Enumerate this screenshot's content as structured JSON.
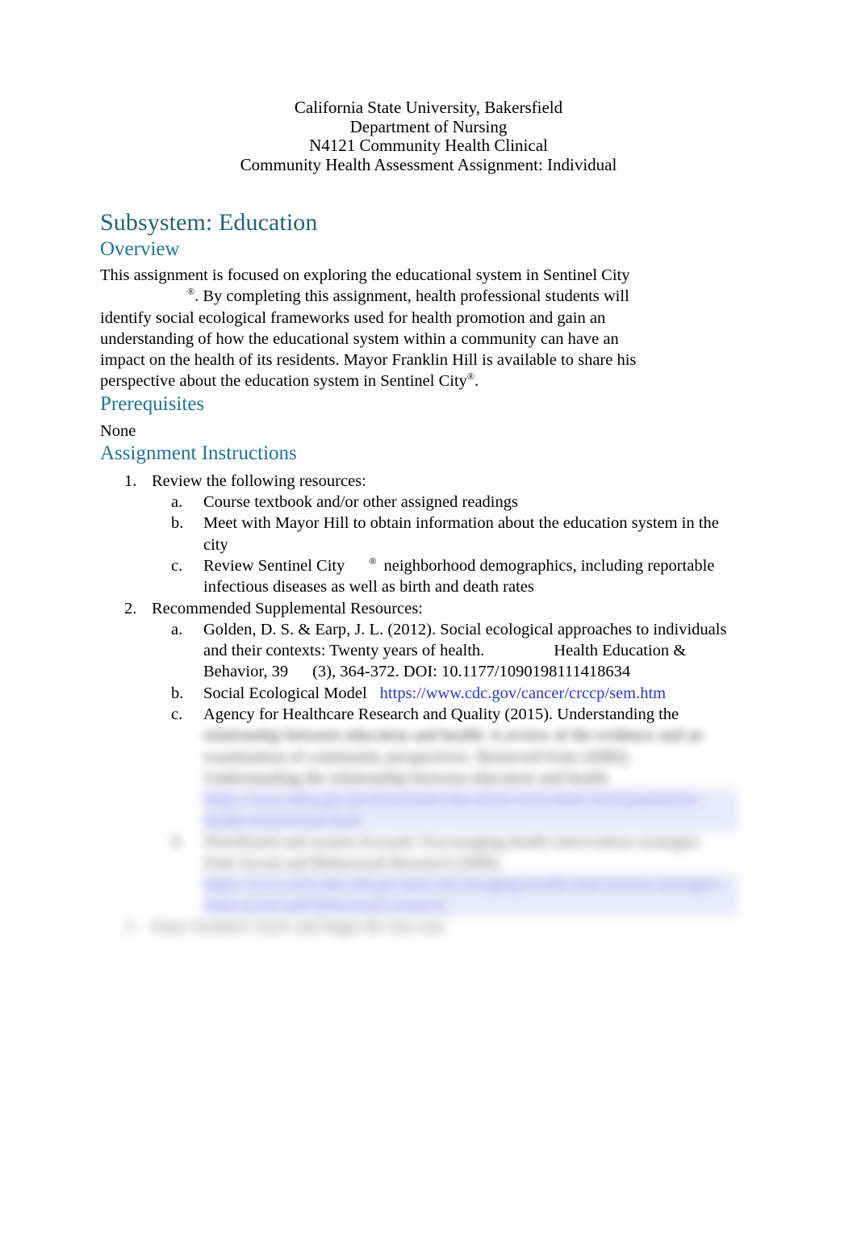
{
  "header": {
    "lines": [
      "California State University, Bakersfield",
      "Department of Nursing",
      "N4121 Community Health Clinical",
      "Community Health Assessment Assignment: Individual"
    ]
  },
  "title": "Subsystem: Education",
  "colors": {
    "heading_teal": "#1F7495",
    "title_teal": "#1F6379",
    "link_blue": "#2B37D0",
    "page_background": "#FFFFFF",
    "body_text": "#000000"
  },
  "sections": {
    "overview": {
      "heading": "Overview",
      "p1_a": "This assignment is focused on exploring the educational system in Sentinel City",
      "p1_reg": "®",
      "p1_b": ". By completing this assignment, health professional students will identify social ecological frameworks used for health promotion and gain an understanding of how the educational system within a community can have an impact on the health of its residents. Mayor Franklin Hill is available to share his perspective about the education system in Sentinel City",
      "p1_reg2": "®",
      "p1_c": "."
    },
    "prerequisites": {
      "heading": "Prerequisites",
      "body": "None"
    },
    "instructions": {
      "heading": "Assignment Instructions",
      "items": [
        {
          "marker": "1.",
          "text": "Review the following resources:",
          "sub": [
            {
              "marker": "a.",
              "text": "Course textbook and/or other assigned readings"
            },
            {
              "marker": "b.",
              "text": "Meet with Mayor Hill to obtain information about the education system in the city"
            },
            {
              "marker": "c.",
              "text_a": "Review Sentinel City",
              "reg": "®",
              "text_b": "neighborhood demographics, including reportable infectious diseases as well as birth and death rates"
            }
          ]
        },
        {
          "marker": "2.",
          "text": "Recommended Supplemental Resources:",
          "sub": [
            {
              "marker": "a.",
              "text_a": "Golden, D. S. & Earp, J. L. (2012). Social ecological approaches to individuals and their contexts: Twenty years of health.",
              "text_b": "Health Education & Behavior, 39",
              "text_c": "(3), 364-372. DOI: 10.1177/1090198111418634"
            },
            {
              "marker": "b.",
              "text_a": "Social Ecological Model",
              "link": "https://www.cdc.gov/cancer/crccp/sem.htm"
            },
            {
              "marker": "c.",
              "text_a": "Agency for Healthcare Research and Quality (2015). Understanding the",
              "obscured_line_1": "relationship between education and health: A review of the evidence and an",
              "obscured_line_2": "examination of community perspectives. Retrieved from AHRQ.",
              "obscured_line_3": "Understanding the relationship between education and health",
              "obscured_link": "https://www.ahrq.gov/professionals/education/curriculum-tools/population-health/zimmerman.html"
            },
            {
              "marker": "d.",
              "obscured_line_1": "Distributed and system focused: Encouraging health intervention strategies",
              "obscured_line_2": "from Social and Behavioral Research (2000)",
              "obscured_link": "https://www.ncbi.nlm.nih.gov/pmc/encouraging-health-intervention-strategies-from-social-and-behavioral-research"
            }
          ]
        },
        {
          "marker": "3.",
          "obscured_text": "Enter Sentinel City® and begin the Sun tour."
        }
      ]
    }
  }
}
